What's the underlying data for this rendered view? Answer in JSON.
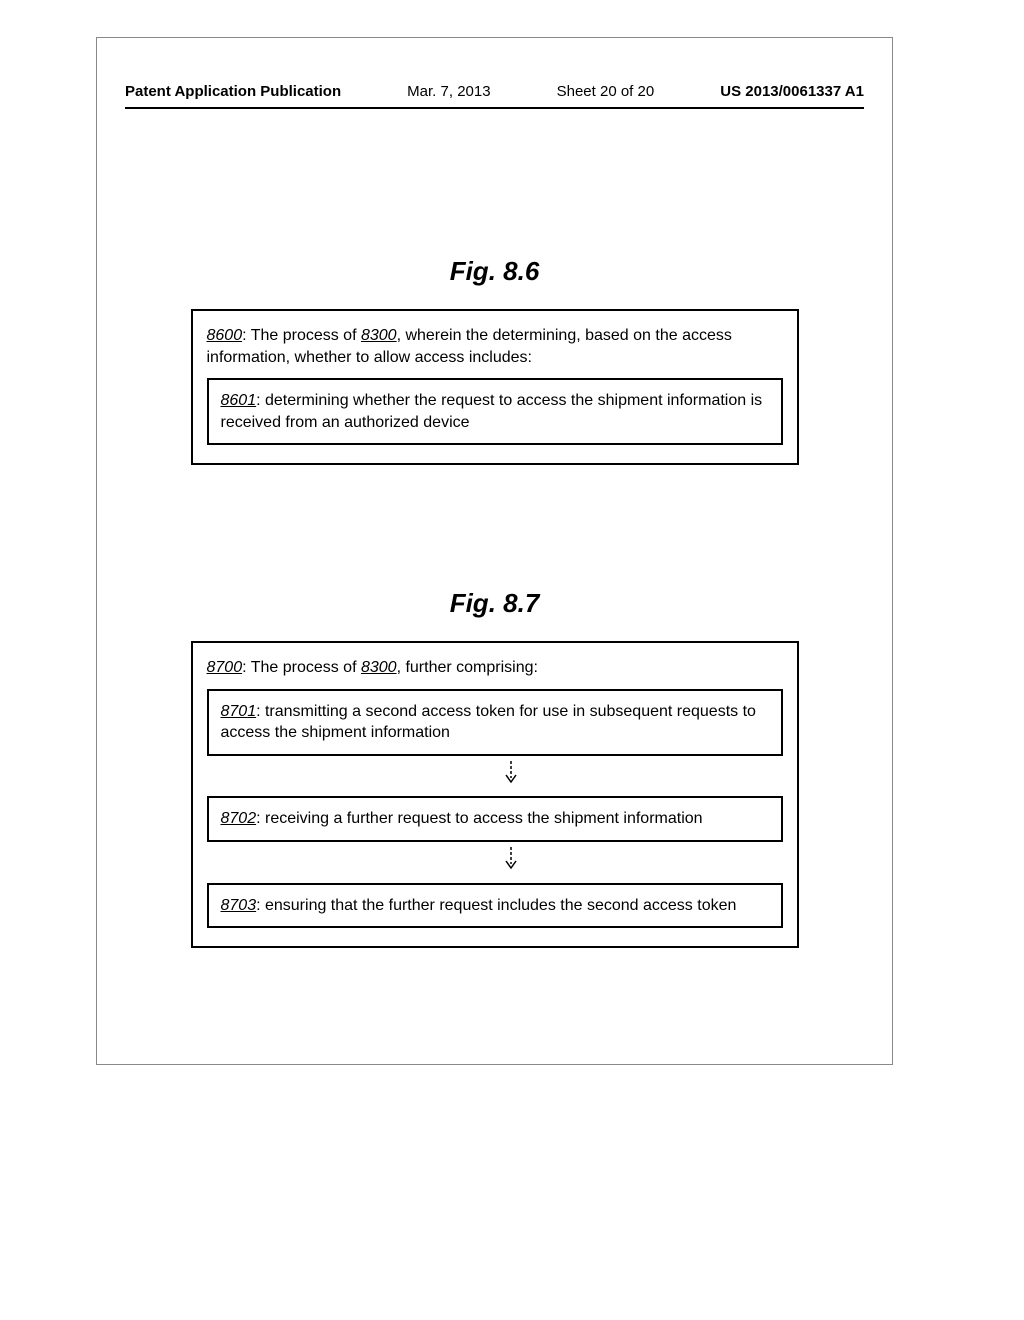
{
  "header": {
    "pub_label": "Patent Application Publication",
    "date": "Mar. 7, 2013",
    "sheet": "Sheet 20 of 20",
    "pub_num": "US 2013/0061337 A1"
  },
  "fig86": {
    "title": "Fig. 8.6",
    "outer_ref": "8600",
    "outer_mid": ": The process of ",
    "outer_ref2": "8300",
    "outer_tail": ", wherein the determining, based on the access information, whether to allow access includes:",
    "inner_ref": "8601",
    "inner_text": ": determining whether the request to access the shipment information is received from an authorized device"
  },
  "fig87": {
    "title": "Fig. 8.7",
    "outer_ref": "8700",
    "outer_mid": ": The process of ",
    "outer_ref2": "8300",
    "outer_tail": ", further comprising:",
    "step1_ref": "8701",
    "step1_text": ": transmitting a second access token for use in subsequent requests to access the shipment information",
    "step2_ref": "8702",
    "step2_text": ": receiving a further request to access the shipment information",
    "step3_ref": "8703",
    "step3_text": ": ensuring that the further request includes the second access token"
  }
}
